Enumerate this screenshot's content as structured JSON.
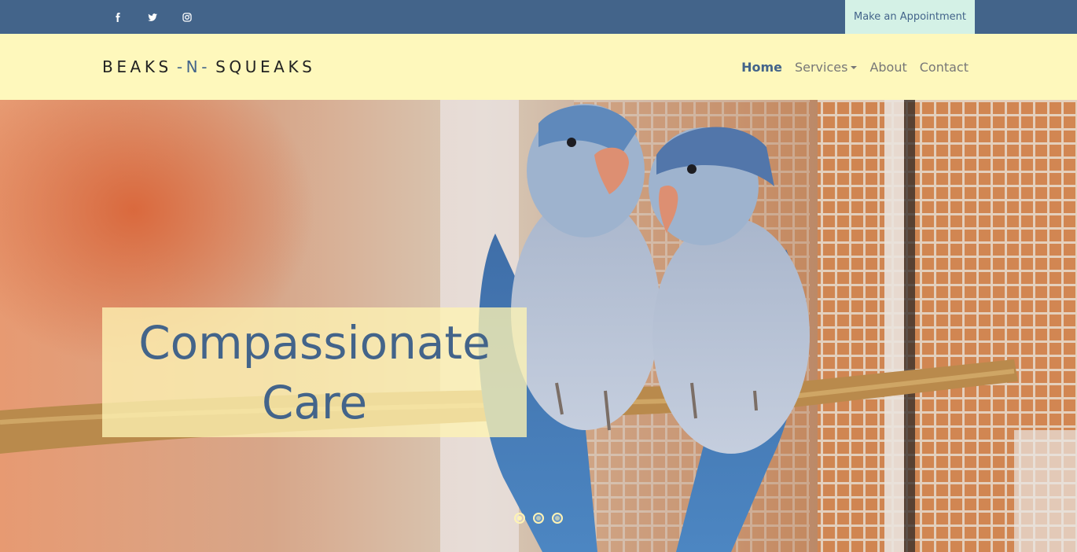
{
  "topbar": {
    "background": "#43648a",
    "social": [
      {
        "icon": "facebook-icon"
      },
      {
        "icon": "twitter-icon"
      },
      {
        "icon": "instagram-icon"
      }
    ],
    "appointment_label": "Make an Appointment"
  },
  "navbar": {
    "background": "#fef8bc",
    "brand": {
      "left": "BEAKS",
      "middle": "-N-",
      "right": "SQUEAKS"
    },
    "items": [
      {
        "label": "Home",
        "active": true
      },
      {
        "label": "Services",
        "dropdown": true
      },
      {
        "label": "About"
      },
      {
        "label": "Contact"
      }
    ]
  },
  "hero": {
    "caption_line1": "Compassionate",
    "caption_line2": "Care",
    "accent_color": "#43648a",
    "slides_count": 3,
    "active_slide": 1
  }
}
